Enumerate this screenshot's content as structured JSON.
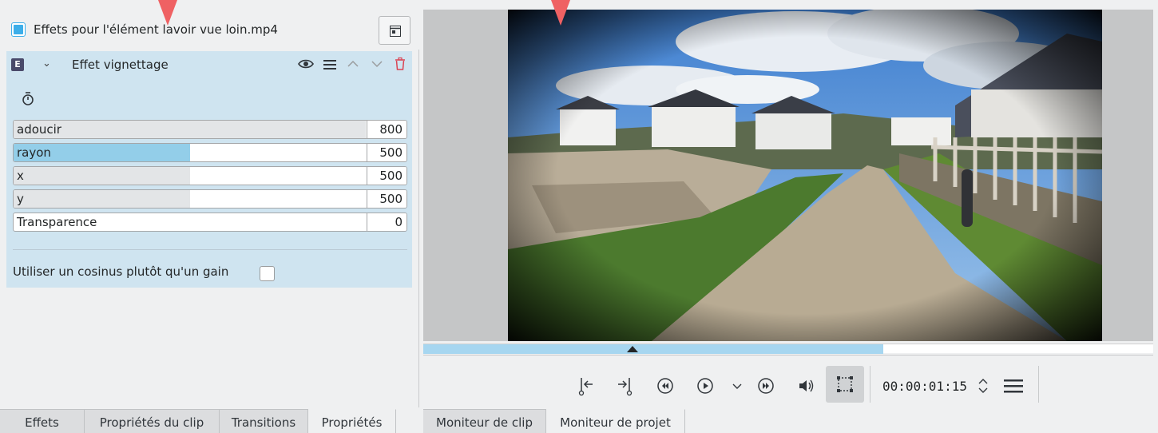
{
  "effects_panel": {
    "header_title": "Effets pour l'élément lavoir vue loin.mp4",
    "effect": {
      "badge": "E",
      "name": "Effet vignettage",
      "params": [
        {
          "label": "adoucir",
          "value": "800",
          "fill_fraction": 1.0,
          "style": "light"
        },
        {
          "label": "rayon",
          "value": "500",
          "fill_fraction": 0.5,
          "style": "blue"
        },
        {
          "label": "x",
          "value": "500",
          "fill_fraction": 0.5,
          "style": "light"
        },
        {
          "label": "y",
          "value": "500",
          "fill_fraction": 0.5,
          "style": "light"
        },
        {
          "label": "Transparence",
          "value": "0",
          "fill_fraction": 0.0,
          "style": "light"
        }
      ],
      "cosinus_label": "Utiliser un cosinus plutôt qu'un gain",
      "cosinus_checked": false
    }
  },
  "monitor": {
    "timecode": "00:00:01:15",
    "timeline_progress_fraction": 0.63
  },
  "tabs_left": [
    {
      "label": "Effets",
      "active": false
    },
    {
      "label": "Propriétés du clip",
      "active": false
    },
    {
      "label": "Transitions",
      "active": false
    },
    {
      "label": "Propriétés",
      "active": true
    }
  ],
  "tabs_right": [
    {
      "label": "Moniteur de clip",
      "active": false
    },
    {
      "label": "Moniteur de projet",
      "active": true
    }
  ],
  "colors": {
    "accent": "#3daee9",
    "effect_bg": "#cfe4f0",
    "annotation_arrow": "#ef6163",
    "delete": "#da4453"
  }
}
